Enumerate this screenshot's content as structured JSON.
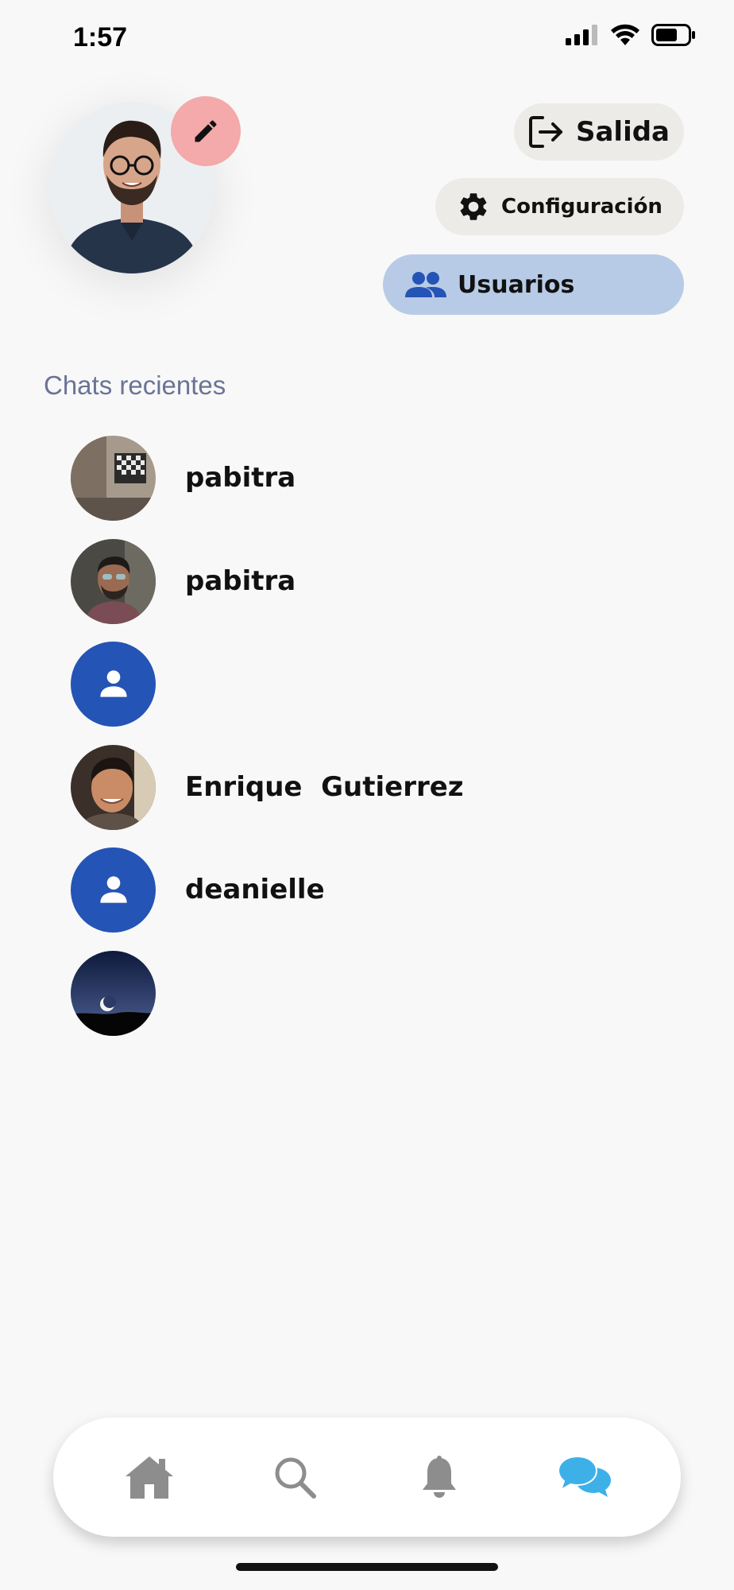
{
  "status_bar": {
    "time": "1:57",
    "icons": [
      "cellular-signal-icon",
      "wifi-icon",
      "battery-icon"
    ]
  },
  "profile": {
    "photo": "profile-photo",
    "edit_icon": "pencil-icon",
    "edit_button_color": "#f4a9aa"
  },
  "actions": {
    "salida": {
      "label": "Salida",
      "icon": "logout-icon"
    },
    "configuracion": {
      "label": "Configuración",
      "icon": "gear-icon"
    },
    "usuarios": {
      "label": "Usuarios",
      "icon": "users-icon",
      "bg": "#b7cbe6",
      "icon_color": "#2454b5"
    }
  },
  "section_title": "Chats recientes",
  "chats": [
    {
      "name": "pabitra",
      "avatar": "photo"
    },
    {
      "name": "pabitra",
      "avatar": "photo"
    },
    {
      "name": "",
      "avatar": "placeholder"
    },
    {
      "name": "Enrique  Gutierrez",
      "avatar": "photo"
    },
    {
      "name": "deanielle",
      "avatar": "placeholder"
    },
    {
      "name": "",
      "avatar": "photo"
    }
  ],
  "bottom_nav": {
    "items": [
      "home-icon",
      "search-icon",
      "bell-icon",
      "chat-bubbles-icon"
    ],
    "active": "chat-bubbles-icon",
    "active_color": "#3eb0e8",
    "inactive_color": "#8d8d8d"
  }
}
